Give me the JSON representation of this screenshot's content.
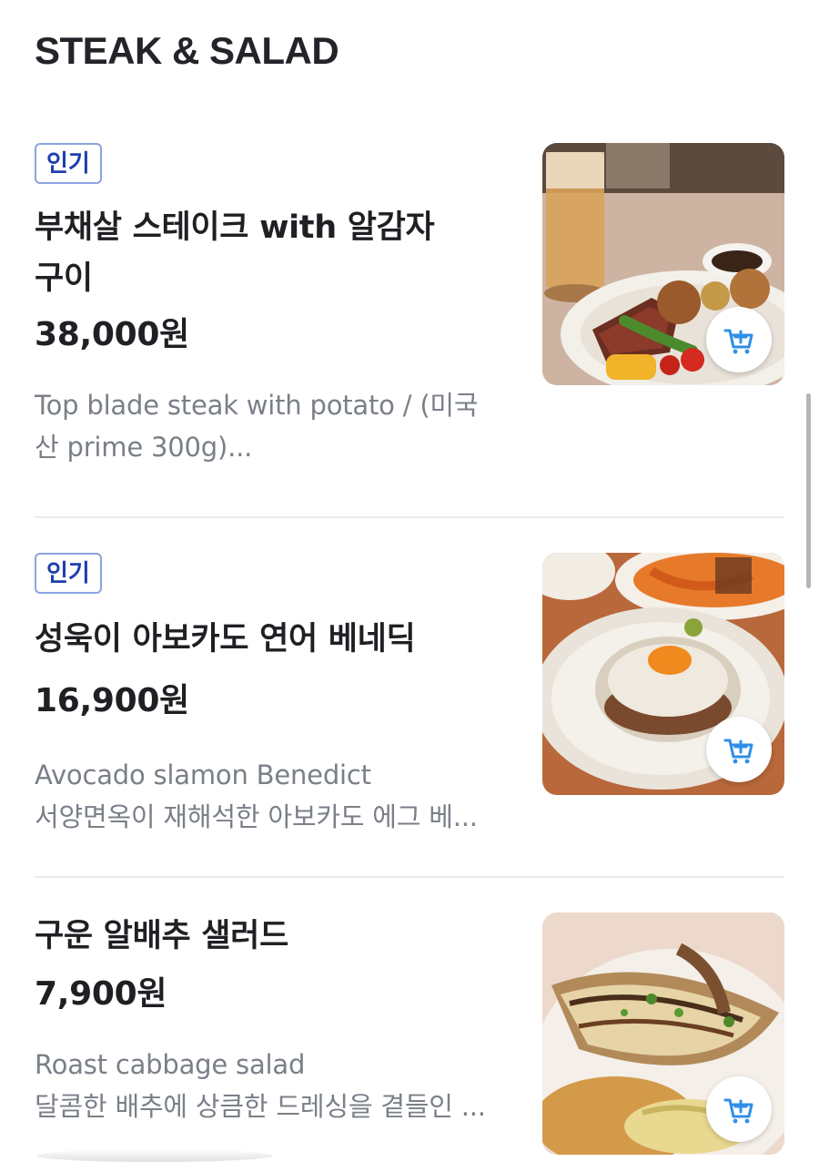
{
  "section": {
    "title": "STEAK & SALAD"
  },
  "items": [
    {
      "badge": "인기",
      "name_line1": "부채살 스테이크 with 알감자",
      "name_line2": "구이",
      "price": "38,000원",
      "desc_line1": "Top blade steak with potato / (미국",
      "desc_line2": "산 prime 300g)...",
      "image": "steak-with-potatoes-photo",
      "cart_icon": "add-to-cart-icon"
    },
    {
      "badge": "인기",
      "name_line1": "성욱이 아보카도 연어 베네딕",
      "price": "16,900원",
      "desc_line1": "Avocado slamon Benedict",
      "desc_line2": "서양면옥이 재해석한 아보카도 에그 베...",
      "image": "avocado-salmon-benedict-photo",
      "cart_icon": "add-to-cart-icon"
    },
    {
      "name_line1": "구운 알배추 샐러드",
      "price": "7,900원",
      "desc_line1": "Roast cabbage salad",
      "desc_line2": "달콤한 배추에 상큼한 드레싱을 곁들인 ...",
      "image": "roast-cabbage-salad-photo",
      "cart_icon": "add-to-cart-icon"
    }
  ],
  "colors": {
    "badge_border": "#8aa4e0",
    "badge_text": "#1f3fae",
    "cart_icon": "#2f8fe8",
    "description": "#7a7f88"
  }
}
